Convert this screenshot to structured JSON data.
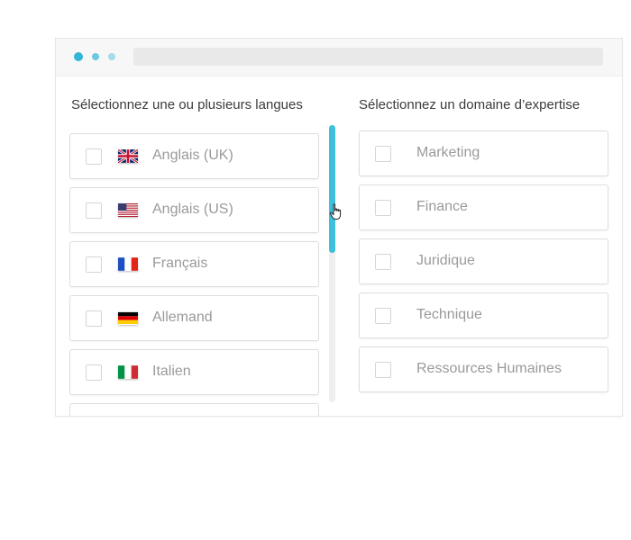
{
  "window": {
    "accent_color": "#32b5d6"
  },
  "languages": {
    "title": "Sélectionnez une ou plusieurs langues",
    "items": [
      {
        "label": "Anglais (UK)",
        "flag": "uk-flag-icon",
        "checked": false
      },
      {
        "label": "Anglais (US)",
        "flag": "us-flag-icon",
        "checked": false
      },
      {
        "label": "Français",
        "flag": "france-flag-icon",
        "checked": false
      },
      {
        "label": "Allemand",
        "flag": "germany-flag-icon",
        "checked": false
      },
      {
        "label": "Italien",
        "flag": "italy-flag-icon",
        "checked": false
      }
    ],
    "scrollbar_color": "#3ebfdc"
  },
  "domains": {
    "title": "Sélectionnez un domaine d’expertise",
    "items": [
      {
        "label": "Marketing",
        "checked": false
      },
      {
        "label": "Finance",
        "checked": false
      },
      {
        "label": "Juridique",
        "checked": false
      },
      {
        "label": "Technique",
        "checked": false
      },
      {
        "label": "Ressources Humaines",
        "checked": false
      }
    ]
  }
}
